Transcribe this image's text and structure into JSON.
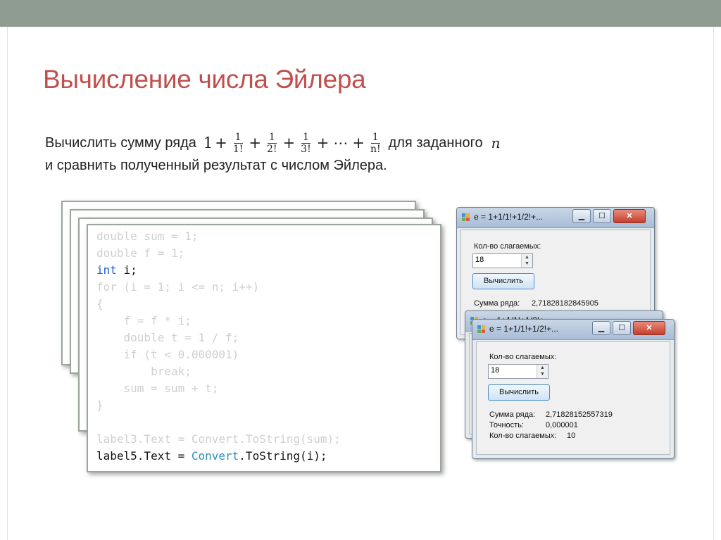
{
  "slide": {
    "title": "Вычисление числа Эйлера",
    "task_prefix": "Вычислить сумму ряда",
    "formula": {
      "one": "1",
      "plus": "+",
      "ellipsis": "⋯",
      "frac_num": "1",
      "den1": "1!",
      "den2": "2!",
      "den3": "3!",
      "denn": "n!"
    },
    "task_suffix": "для заданного",
    "n": "n",
    "task_line2": "и сравнить полученный результат с числом Эйлера."
  },
  "code": {
    "l1": "double sum = 1;",
    "l2": "double f = 1;",
    "l3_kw": "int",
    "l3_rest": " i;",
    "l4": "for (i = 1; i <= n; i++)",
    "l5": "{",
    "l6": "    f = f * i;",
    "l7": "    double t = 1 / f;",
    "l8": "    if (t < 0.000001)",
    "l9": "        break;",
    "l10": "    sum = sum + t;",
    "l11": "}",
    "l12": "label3.Text = Convert.ToString(sum);",
    "l13_a": "label5.Text = ",
    "l13_b": "Convert",
    "l13_c": ".ToString(i);"
  },
  "window1": {
    "title": "e = 1+1/1!+1/2!+...",
    "count_label": "Кол-во слагаемых:",
    "count_value": "18",
    "button": "Вычислить",
    "sum_label": "Сумма ряда:",
    "sum_value": "2,71828182845905"
  },
  "window2": {
    "title": "e = 1+1/1!+1/2!+..."
  },
  "window3": {
    "title": "e = 1+1/1!+1/2!+...",
    "count_label": "Кол-во слагаемых:",
    "count_value": "18",
    "button": "Вычислить",
    "sum_label": "Сумма ряда:",
    "sum_value": "2,71828152557319",
    "accuracy_label": "Точность:",
    "accuracy_value": "0,000001",
    "terms_label": "Кол-во слагаемых:",
    "terms_value": "10"
  },
  "window_controls": {
    "minimize": "▁",
    "maximize": "☐",
    "close": "✕",
    "spin_up": "▲",
    "spin_down": "▼"
  }
}
